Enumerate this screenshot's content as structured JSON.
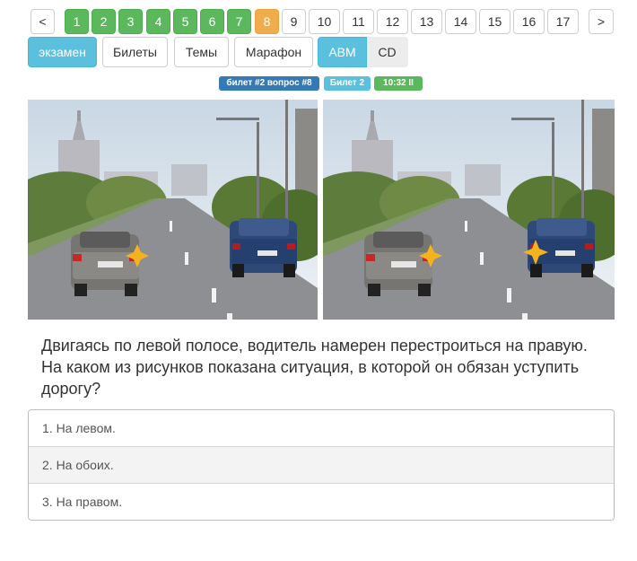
{
  "pagination": {
    "prev_label": "<",
    "next_label": ">",
    "pages": [
      {
        "label": "1",
        "state": "done"
      },
      {
        "label": "2",
        "state": "done"
      },
      {
        "label": "3",
        "state": "done"
      },
      {
        "label": "4",
        "state": "done"
      },
      {
        "label": "5",
        "state": "done"
      },
      {
        "label": "6",
        "state": "done"
      },
      {
        "label": "7",
        "state": "done"
      },
      {
        "label": "8",
        "state": "current"
      },
      {
        "label": "9",
        "state": "pending"
      },
      {
        "label": "10",
        "state": "pending"
      },
      {
        "label": "11",
        "state": "pending"
      },
      {
        "label": "12",
        "state": "pending"
      },
      {
        "label": "13",
        "state": "pending"
      },
      {
        "label": "14",
        "state": "pending"
      },
      {
        "label": "15",
        "state": "pending"
      },
      {
        "label": "16",
        "state": "pending"
      },
      {
        "label": "17",
        "state": "pending"
      }
    ]
  },
  "modes": {
    "exam": "экзамен",
    "tickets": "Билеты",
    "topics": "Темы",
    "marathon": "Марафон",
    "category_abm": "ABM",
    "category_cd": "CD"
  },
  "badges": {
    "ticket_question": "билет #2 вопрос #8",
    "ticket": "Билет 2",
    "timer": "10:32 II"
  },
  "question": {
    "text": "Двигаясь по левой полосе, водитель намерен перестроиться на правую. На каком из рисунков показана ситуация, в которой он обязан уступить дорогу?"
  },
  "answers": [
    "1. На левом.",
    "2. На обоих.",
    "3. На правом."
  ],
  "colors": {
    "done": "#5cb85c",
    "current": "#f0ad4e",
    "info": "#5bc0de",
    "badge_primary": "#337ab7",
    "badge_info": "#5bc0de",
    "badge_success": "#5cb85c",
    "turn_signal": "#f5b21f"
  }
}
